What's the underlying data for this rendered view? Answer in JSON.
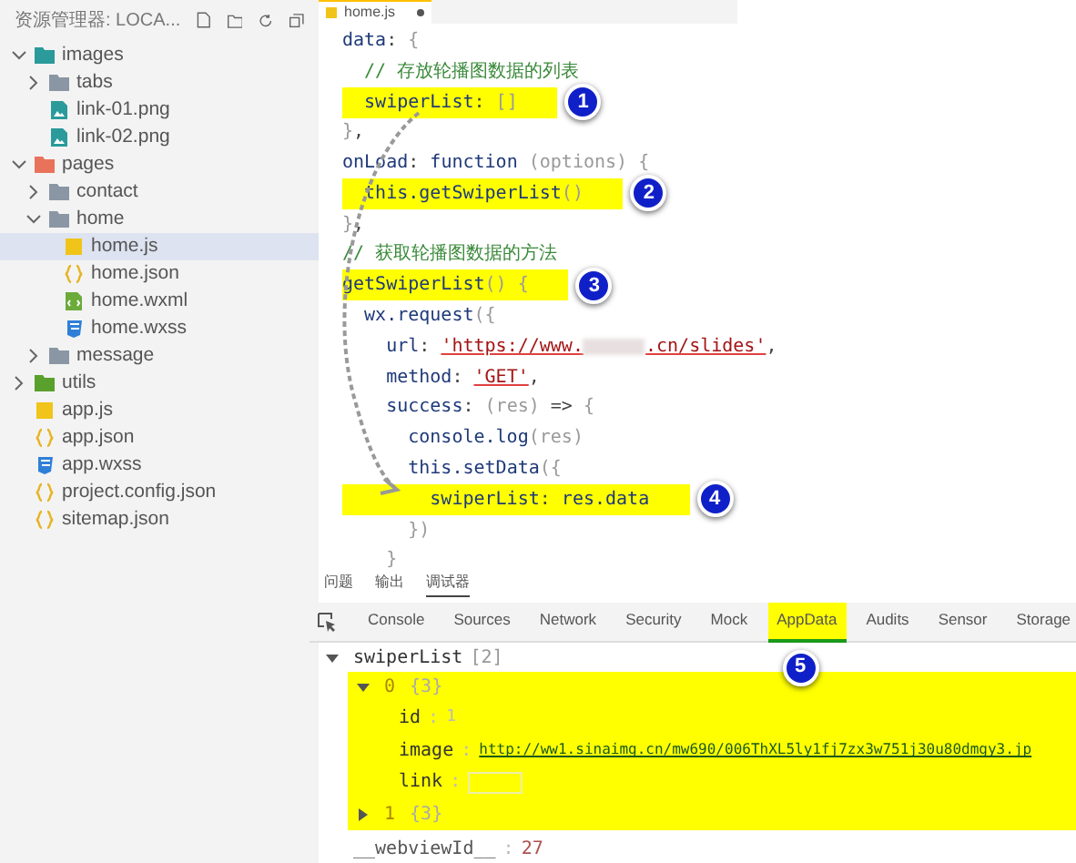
{
  "explorer": {
    "title": "资源管理器: LOCA...",
    "tree": [
      {
        "label": "images",
        "kind": "assets",
        "expanded": true,
        "selected": false,
        "children": [
          {
            "label": "tabs",
            "kind": "folder",
            "expanded": false,
            "selected": false
          },
          {
            "label": "link-01.png",
            "kind": "image",
            "selected": false
          },
          {
            "label": "link-02.png",
            "kind": "image",
            "selected": false
          }
        ]
      },
      {
        "label": "pages",
        "kind": "pages",
        "expanded": true,
        "selected": false,
        "children": [
          {
            "label": "contact",
            "kind": "folder",
            "expanded": false,
            "selected": false
          },
          {
            "label": "home",
            "kind": "folder",
            "expanded": true,
            "selected": false,
            "children": [
              {
                "label": "home.js",
                "kind": "js",
                "selected": true
              },
              {
                "label": "home.json",
                "kind": "json",
                "selected": false
              },
              {
                "label": "home.wxml",
                "kind": "wxml",
                "selected": false
              },
              {
                "label": "home.wxss",
                "kind": "wxss",
                "selected": false
              }
            ]
          },
          {
            "label": "message",
            "kind": "folder",
            "expanded": false,
            "selected": false
          }
        ]
      },
      {
        "label": "utils",
        "kind": "utils",
        "expanded": false,
        "selected": false
      },
      {
        "label": "app.js",
        "kind": "js",
        "selected": false
      },
      {
        "label": "app.json",
        "kind": "json",
        "selected": false
      },
      {
        "label": "app.wxss",
        "kind": "wxss",
        "selected": false
      },
      {
        "label": "project.config.json",
        "kind": "json",
        "selected": false
      },
      {
        "label": "sitemap.json",
        "kind": "json",
        "selected": false
      }
    ]
  },
  "editor": {
    "tab": "home.js",
    "modified": true,
    "lines": [
      {
        "highlighted": false,
        "tokens": [
          {
            "kind": "key",
            "text": "data"
          },
          {
            "kind": "punct",
            "text": ": "
          },
          {
            "kind": "brace",
            "text": "{"
          }
        ]
      },
      {
        "highlighted": false,
        "tokens": [
          {
            "kind": "comment",
            "text": "  // 存放轮播图数据的列表"
          }
        ]
      },
      {
        "highlighted": true,
        "badge": "1",
        "tokens": [
          {
            "kind": "key",
            "text": "  swiperList"
          },
          {
            "kind": "punct",
            "text": ": "
          },
          {
            "kind": "brace",
            "text": "[]"
          }
        ]
      },
      {
        "highlighted": false,
        "tokens": [
          {
            "kind": "brace",
            "text": "}"
          },
          {
            "kind": "punct",
            "text": ","
          }
        ]
      },
      {
        "highlighted": false,
        "tokens": [
          {
            "kind": "key",
            "text": "onLoad"
          },
          {
            "kind": "punct",
            "text": ": "
          },
          {
            "kind": "keyword",
            "text": "function"
          },
          {
            "kind": "brace",
            "text": " (options) {"
          }
        ]
      },
      {
        "highlighted": true,
        "badge": "2",
        "tokens": [
          {
            "kind": "keyword",
            "text": "  this"
          },
          {
            "kind": "key",
            "text": ".getSwiperList"
          },
          {
            "kind": "brace",
            "text": "()"
          }
        ]
      },
      {
        "highlighted": false,
        "tokens": [
          {
            "kind": "brace",
            "text": "}"
          },
          {
            "kind": "punct",
            "text": ","
          }
        ]
      },
      {
        "highlighted": false,
        "tokens": [
          {
            "kind": "comment",
            "text": "// 获取轮播图数据的方法"
          }
        ]
      },
      {
        "highlighted": true,
        "badge": "3",
        "tokens": [
          {
            "kind": "key",
            "text": "getSwiperList"
          },
          {
            "kind": "brace",
            "text": "() {"
          }
        ]
      },
      {
        "highlighted": false,
        "tokens": [
          {
            "kind": "key",
            "text": "  wx.request"
          },
          {
            "kind": "brace",
            "text": "({"
          }
        ]
      },
      {
        "highlighted": false,
        "tokens": [
          {
            "kind": "key",
            "text": "    url"
          },
          {
            "kind": "punct",
            "text": ": "
          },
          {
            "kind": "string",
            "text": "'https://www."
          },
          {
            "kind": "blur"
          },
          {
            "kind": "string",
            "text": ".cn/slides'"
          },
          {
            "kind": "punct",
            "text": ","
          }
        ]
      },
      {
        "highlighted": false,
        "tokens": [
          {
            "kind": "key",
            "text": "    method"
          },
          {
            "kind": "punct",
            "text": ": "
          },
          {
            "kind": "string",
            "text": "'GET'"
          },
          {
            "kind": "punct",
            "text": ","
          }
        ]
      },
      {
        "highlighted": false,
        "tokens": [
          {
            "kind": "key",
            "text": "    success"
          },
          {
            "kind": "punct",
            "text": ": "
          },
          {
            "kind": "brace",
            "text": "(res)"
          },
          {
            "kind": "punct",
            "text": " => "
          },
          {
            "kind": "brace",
            "text": "{"
          }
        ]
      },
      {
        "highlighted": false,
        "tokens": [
          {
            "kind": "key",
            "text": "      console.log"
          },
          {
            "kind": "brace",
            "text": "(res)"
          }
        ]
      },
      {
        "highlighted": false,
        "tokens": [
          {
            "kind": "keyword",
            "text": "      this"
          },
          {
            "kind": "key",
            "text": ".setData"
          },
          {
            "kind": "brace",
            "text": "({"
          }
        ]
      },
      {
        "highlighted": true,
        "badge": "4",
        "tokens": [
          {
            "kind": "key",
            "text": "        swiperList"
          },
          {
            "kind": "punct",
            "text": ": "
          },
          {
            "kind": "key",
            "text": "res.data"
          }
        ]
      },
      {
        "highlighted": false,
        "tokens": [
          {
            "kind": "brace",
            "text": "      })"
          }
        ]
      },
      {
        "highlighted": false,
        "tokens": [
          {
            "kind": "brace",
            "text": "    }"
          }
        ]
      }
    ]
  },
  "panel_tabs": [
    {
      "label": "问题",
      "selected": false
    },
    {
      "label": "输出",
      "selected": false
    },
    {
      "label": "调试器",
      "selected": true
    }
  ],
  "devtools_tabs": [
    {
      "label": "Console",
      "selected": false,
      "highlighted": false
    },
    {
      "label": "Sources",
      "selected": false,
      "highlighted": false
    },
    {
      "label": "Network",
      "selected": false,
      "highlighted": false
    },
    {
      "label": "Security",
      "selected": false,
      "highlighted": false
    },
    {
      "label": "Mock",
      "selected": false,
      "highlighted": false
    },
    {
      "label": "AppData",
      "selected": true,
      "highlighted": true,
      "badge": "5"
    },
    {
      "label": "Audits",
      "selected": false,
      "highlighted": false
    },
    {
      "label": "Sensor",
      "selected": false,
      "highlighted": false
    },
    {
      "label": "Storage",
      "selected": false,
      "highlighted": false
    }
  ],
  "appdata": {
    "name": "swiperList",
    "count": "[2]",
    "expanded": true,
    "items": [
      {
        "index": "0",
        "count": "{3}",
        "expanded": true,
        "highlighted": true,
        "fields": [
          {
            "key": "id",
            "colon": ":",
            "value": "1",
            "kind": "number"
          },
          {
            "key": "image",
            "colon": ":",
            "value": "http://ww1.sinaimg.cn/mw690/006ThXL5ly1fj7zx3w751j30u80dmgy3.jp",
            "kind": "link"
          },
          {
            "key": "link",
            "colon": ":",
            "kind": "empty"
          }
        ]
      },
      {
        "index": "1",
        "count": "{3}",
        "expanded": false,
        "highlighted": true
      }
    ],
    "webview": {
      "key": "__webviewId__",
      "colon": ":",
      "value": "27"
    }
  }
}
